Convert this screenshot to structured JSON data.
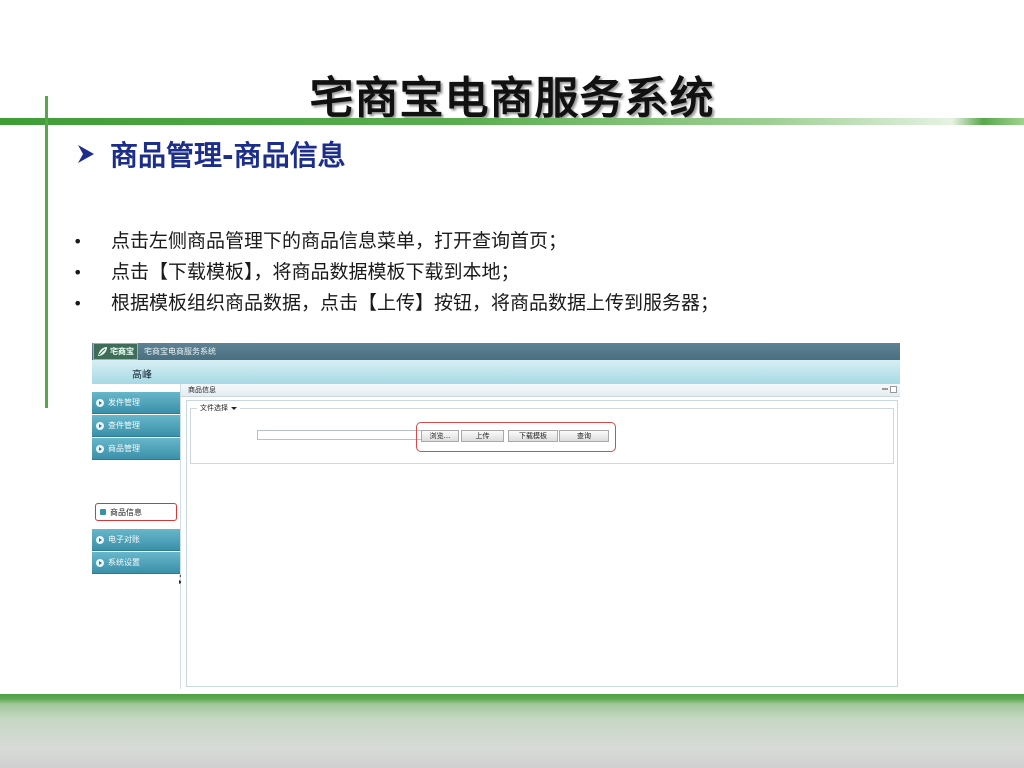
{
  "slide": {
    "title": "宅商宝电商服务系统",
    "section_heading": "商品管理-商品信息",
    "bullets": [
      "点击左侧商品管理下的商品信息菜单，打开查询首页；",
      "点击【下载模板】，将商品数据模板下载到本地；",
      "根据模板组织商品数据，点击【上传】按钮，将商品数据上传到服务器；"
    ],
    "bullet_glyph": "•",
    "colors": {
      "heading": "#1d2e8a",
      "accent_green": "#55a747"
    }
  },
  "app": {
    "logo_text": "宅商宝",
    "window_title": "宅商宝电商服务系统",
    "user_name": "高峰",
    "sidebar": {
      "items": [
        {
          "label": "发件管理"
        },
        {
          "label": "查件管理"
        },
        {
          "label": "商品管理"
        },
        {
          "label": "电子对账"
        },
        {
          "label": "系统设置"
        }
      ],
      "selected_subitem": "商品信息"
    },
    "panel": {
      "title": "商品信息",
      "fieldset_legend": "文件选择",
      "file_input_value": "",
      "buttons": {
        "browse": "浏览...",
        "upload": "上传",
        "download_template": "下载模板",
        "query": "查询"
      }
    },
    "colors": {
      "header": "#496f80",
      "sidebar_item": "#3a90a9",
      "highlight_border": "#d84a4a"
    }
  }
}
